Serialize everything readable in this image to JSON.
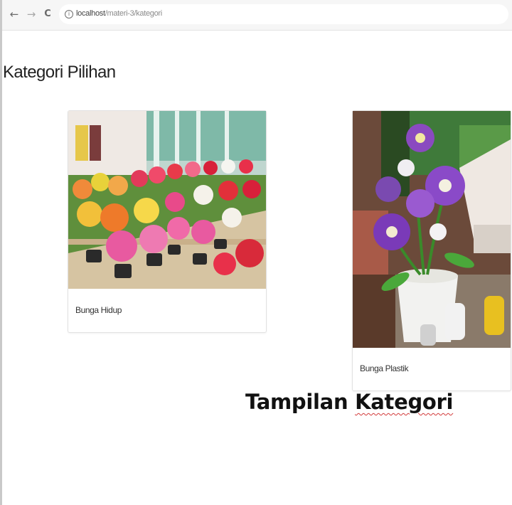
{
  "browser": {
    "url_host": "localhost",
    "url_path": "/materi-3/kategori",
    "back_glyph": "←",
    "forward_glyph": "→",
    "reload_glyph": "C",
    "info_glyph": "i"
  },
  "page": {
    "heading": "Kategori Pilihan"
  },
  "categories": [
    {
      "label": "Bunga Hidup",
      "image_icon": "flower-garden-photo"
    },
    {
      "label": "Bunga Plastik",
      "image_icon": "plastic-flower-vase-photo"
    }
  ],
  "caption": {
    "word1": "Tampilan",
    "word2": "Kategori"
  },
  "colors": {
    "spellcheck_underline": "#d23a3a"
  }
}
